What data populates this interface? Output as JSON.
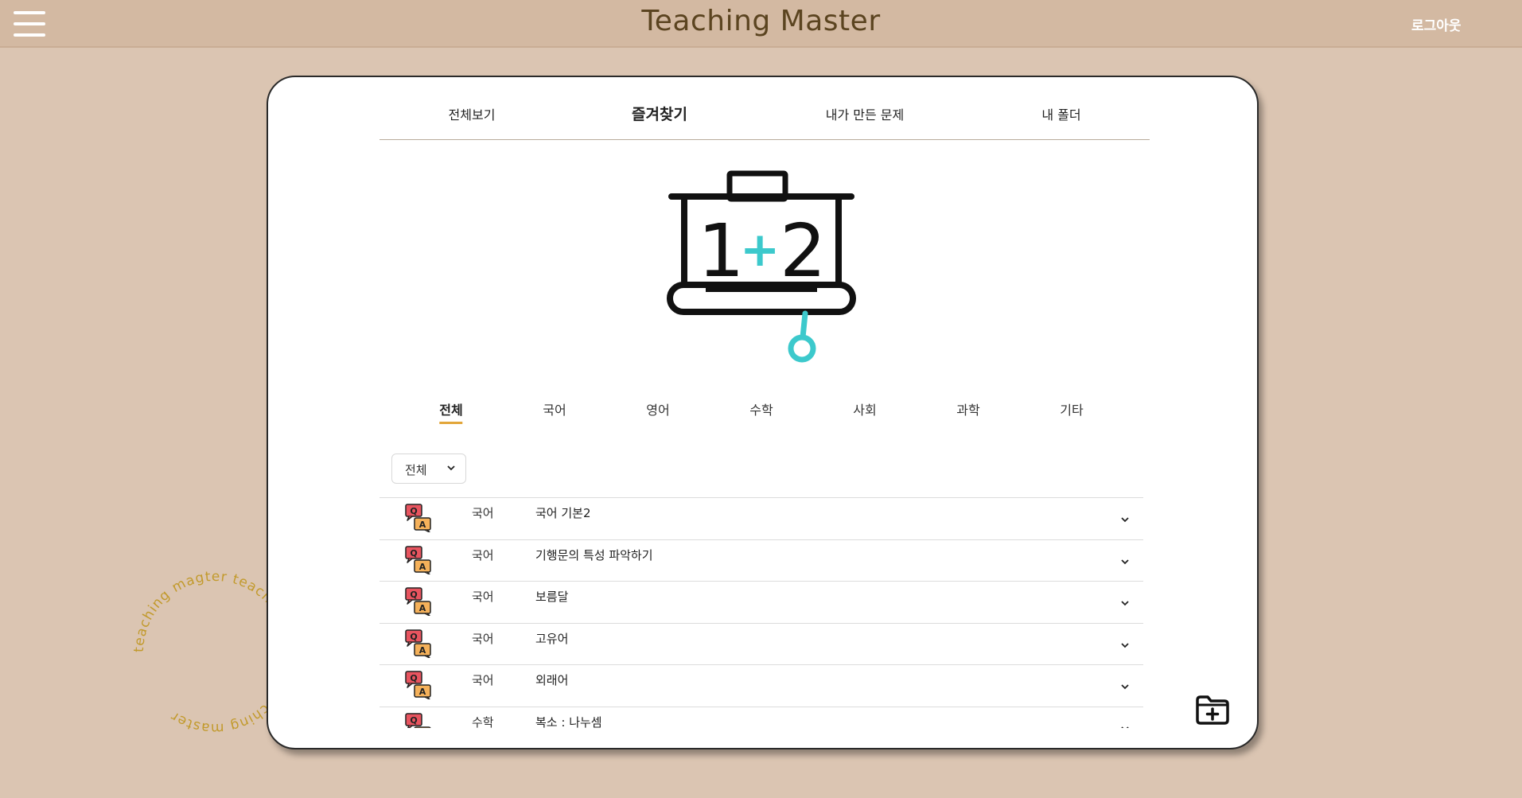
{
  "header": {
    "title": "Teaching Master",
    "logout_label": "로그아웃"
  },
  "top_tabs": [
    {
      "label": "전체보기",
      "active": false
    },
    {
      "label": "즐겨찾기",
      "active": true
    },
    {
      "label": "내가 만든 문제",
      "active": false
    },
    {
      "label": "내 폴더",
      "active": false
    }
  ],
  "board": {
    "text_left": "1",
    "text_plus": "+",
    "text_right": "2"
  },
  "subject_tabs": [
    {
      "label": "전체",
      "active": true
    },
    {
      "label": "국어",
      "active": false
    },
    {
      "label": "영어",
      "active": false
    },
    {
      "label": "수학",
      "active": false
    },
    {
      "label": "사회",
      "active": false
    },
    {
      "label": "과학",
      "active": false
    },
    {
      "label": "기타",
      "active": false
    }
  ],
  "filter": {
    "selected": "전체"
  },
  "problems": [
    {
      "subject": "국어",
      "title": "국어 기본2"
    },
    {
      "subject": "국어",
      "title": "기행문의 특성 파악하기"
    },
    {
      "subject": "국어",
      "title": "보름달"
    },
    {
      "subject": "국어",
      "title": "고유어"
    },
    {
      "subject": "국어",
      "title": "외래어"
    },
    {
      "subject": "수학",
      "title": "복소 : 나누셈"
    }
  ],
  "qa_icon": {
    "q": "Q",
    "a": "A"
  },
  "ring_text": "teaching magter teaching master teaching master ",
  "colors": {
    "background": "#dbc5b2",
    "header": "#d3b9a2",
    "title_text": "#5b4420",
    "accent_teal": "#3cc9cc",
    "tab_underline": "#e2a63a",
    "ring_text": "#c29a2c",
    "q_bubble": "#e8545f",
    "a_bubble": "#f5b15a"
  },
  "icons": [
    "hamburger-icon",
    "chevron-down-icon",
    "qa-icon",
    "folder-plus-icon"
  ]
}
